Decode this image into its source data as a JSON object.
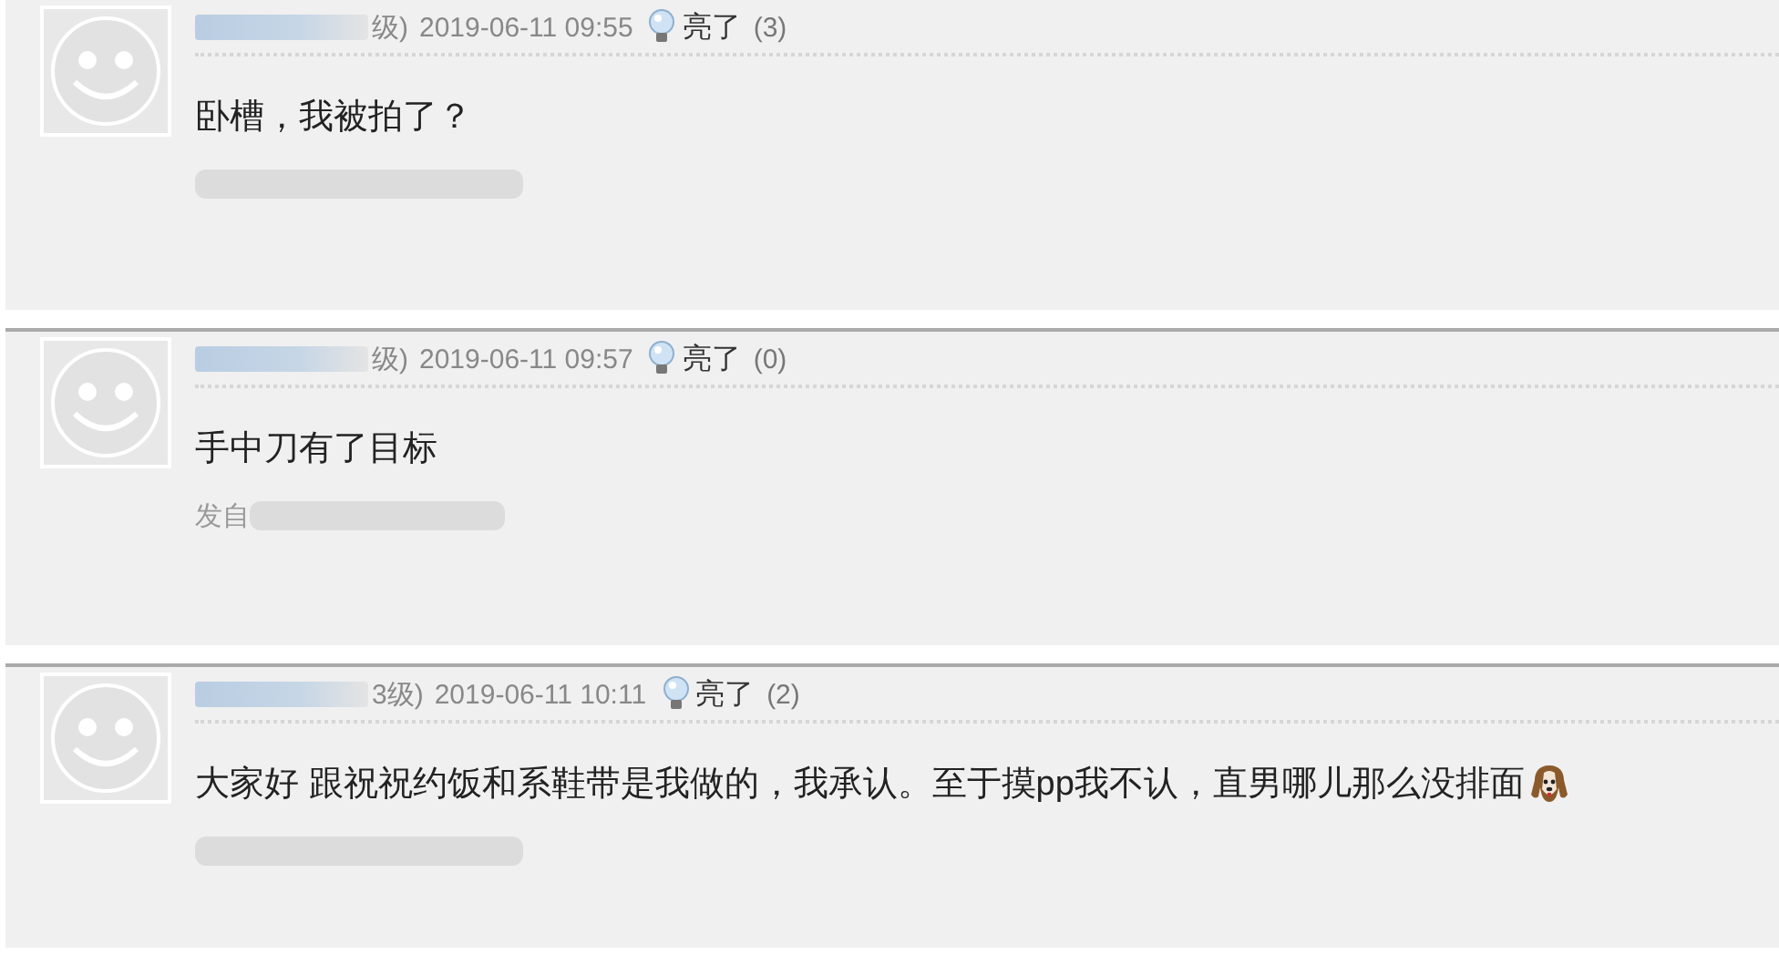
{
  "posts": [
    {
      "name_redacted": true,
      "name_tail": "级)",
      "time": "2019-06-11 09:55",
      "like_label": "亮了",
      "like_count": "(3)",
      "body": "卧槽，我被拍了？",
      "emoji": false,
      "footer_redacted": true
    },
    {
      "name_redacted": true,
      "name_tail": "级)",
      "time": "2019-06-11 09:57",
      "like_label": "亮了",
      "like_count": "(0)",
      "body": "手中刀有了目标",
      "emoji": false,
      "footer": "发自",
      "footer_redacted": true
    },
    {
      "name_redacted": true,
      "name_tail": "3级)",
      "time": "2019-06-11 10:11",
      "like_label": "亮了",
      "like_count": "(2)",
      "body": "大家好 跟祝祝约饭和系鞋带是我做的，我承认。至于摸pp我不认，直男哪儿那么没排面",
      "emoji": true,
      "footer_redacted": true
    }
  ]
}
